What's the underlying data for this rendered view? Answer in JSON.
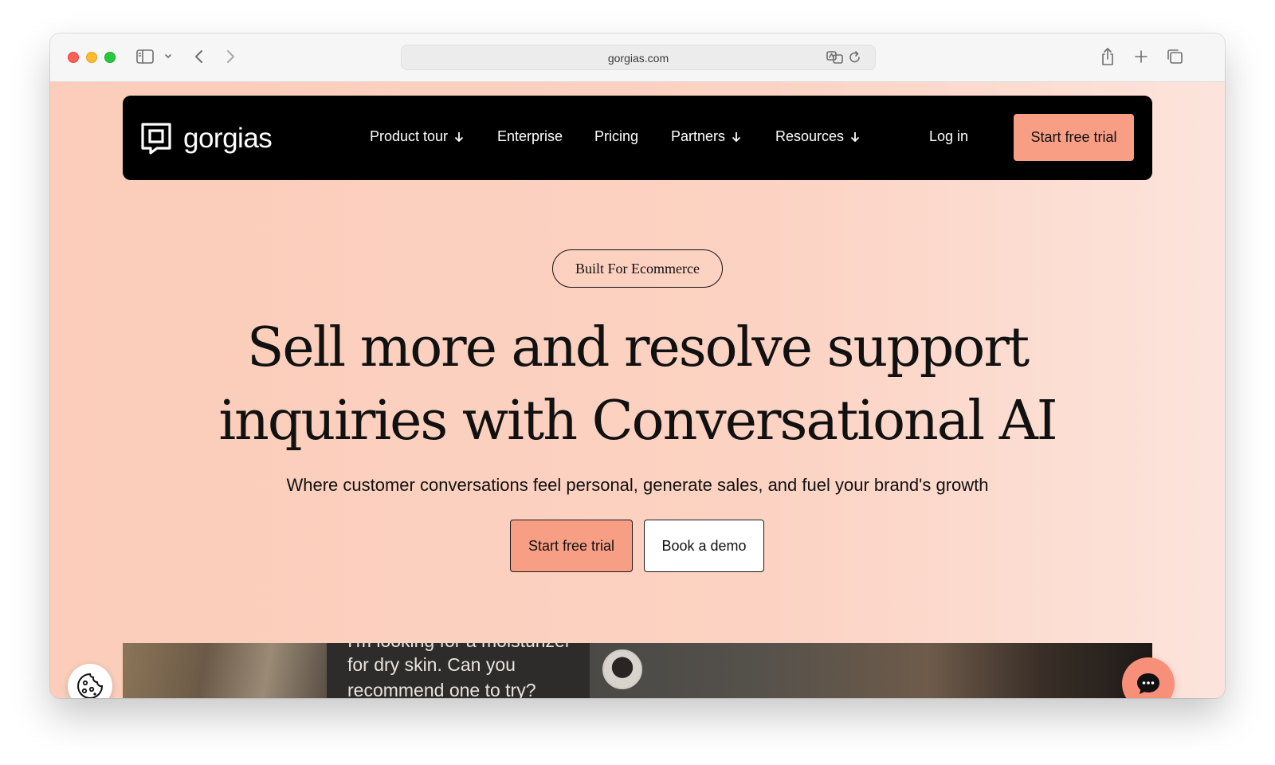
{
  "browser": {
    "url": "gorgias.com",
    "icons": [
      "sidebar-icon",
      "chevron-down-icon",
      "back-icon",
      "forward-icon",
      "translate-icon",
      "reload-icon",
      "share-icon",
      "new-tab-icon",
      "tabs-overview-icon"
    ]
  },
  "nav": {
    "logo_text": "gorgias",
    "items": [
      {
        "label": "Product tour",
        "has_dropdown": true
      },
      {
        "label": "Enterprise",
        "has_dropdown": false
      },
      {
        "label": "Pricing",
        "has_dropdown": false
      },
      {
        "label": "Partners",
        "has_dropdown": true
      },
      {
        "label": "Resources",
        "has_dropdown": true
      }
    ],
    "login_label": "Log in",
    "cta_label": "Start free trial"
  },
  "hero": {
    "badge": "Built For Ecommerce",
    "headline_line1": "Sell more and resolve support",
    "headline_line2": "inquiries with Conversational AI",
    "subheadline": "Where customer conversations feel personal, generate sales, and fuel your brand's growth",
    "primary_cta": "Start free trial",
    "secondary_cta": "Book a demo"
  },
  "media": {
    "bubble_line1": "I'm looking for a moisturizer",
    "bubble_line2": "for dry skin. Can you",
    "bubble_line3": "recommend one to try?"
  },
  "colors": {
    "accent": "#f89e85",
    "page_bg": "#fbd7c8",
    "nav_bg": "#000000"
  }
}
